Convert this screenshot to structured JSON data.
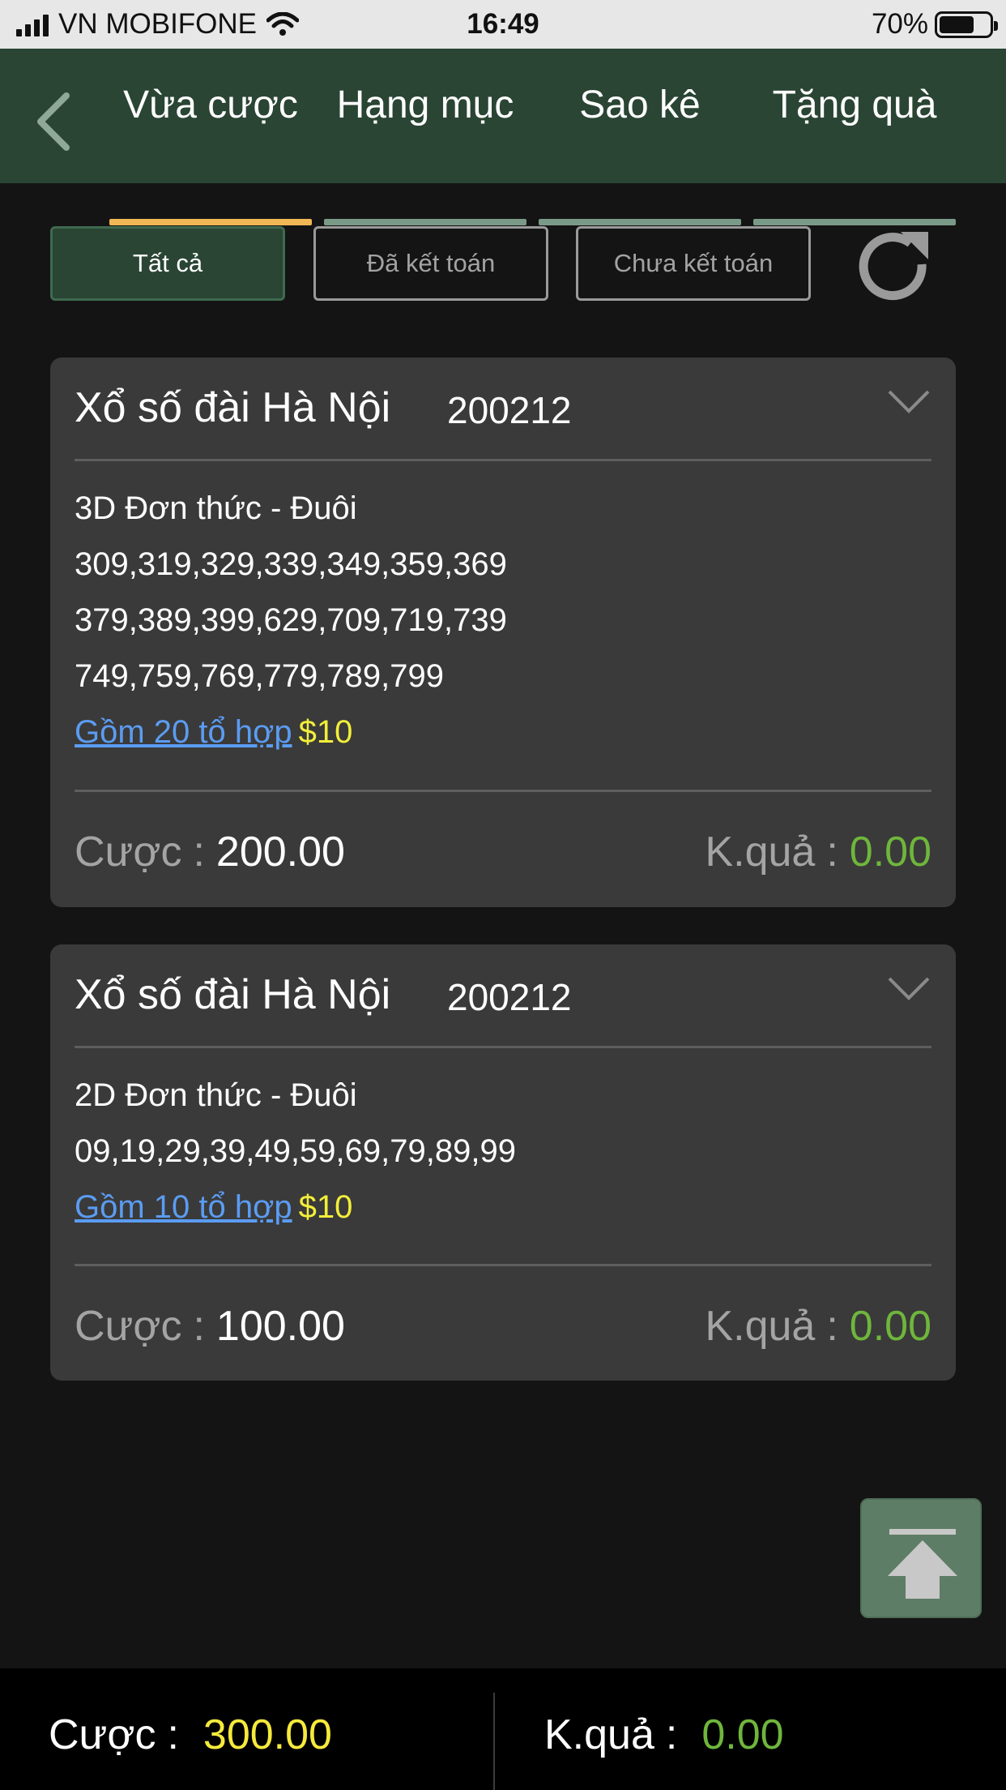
{
  "status_bar": {
    "carrier": "VN MOBIFONE",
    "time": "16:49",
    "battery": "70%",
    "battery_level": 0.7
  },
  "header": {
    "back_icon": "chevron-left-icon",
    "tabs": [
      {
        "label": "Vừa cược",
        "active": true
      },
      {
        "label": "Hạng mục",
        "active": false
      },
      {
        "label": "Sao kê",
        "active": false
      },
      {
        "label": "Tặng quà",
        "active": false
      }
    ],
    "colors": {
      "background": "#2a4534",
      "active_indicator": "#f0b754"
    }
  },
  "filters": {
    "all": "Tất cả",
    "settled": "Đã kết toán",
    "unsettled": "Chưa kết toán",
    "refresh_icon": "refresh-icon"
  },
  "bets": [
    {
      "title": "Xổ số đài Hà Nội",
      "period": "200212",
      "bet_type": "3D Đơn thức - Đuôi",
      "numbers": [
        "309,319,329,339,349,359,369",
        "379,389,399,629,709,719,739",
        "749,759,769,779,789,799"
      ],
      "combo_link": "Gồm 20 tổ hợp",
      "unit_price": "$10",
      "stake_label": "Cược",
      "stake": "200.00",
      "result_label": "K.quả",
      "result": "0.00"
    },
    {
      "title": "Xổ số đài Hà Nội",
      "period": "200212",
      "bet_type": "2D Đơn thức - Đuôi",
      "numbers": [
        "09,19,29,39,49,59,69,79,89,99"
      ],
      "combo_link": "Gồm 10 tổ hợp",
      "unit_price": "$10",
      "stake_label": "Cược",
      "stake": "100.00",
      "result_label": "K.quả",
      "result": "0.00"
    }
  ],
  "scroll_top_icon": "arrow-up-to-top-icon",
  "summary": {
    "stake_label": "Cược",
    "stake": "300.00",
    "result_label": "K.quả",
    "result": "0.00",
    "colors": {
      "stake": "#f5ea3c",
      "result": "#6fb63c"
    }
  }
}
